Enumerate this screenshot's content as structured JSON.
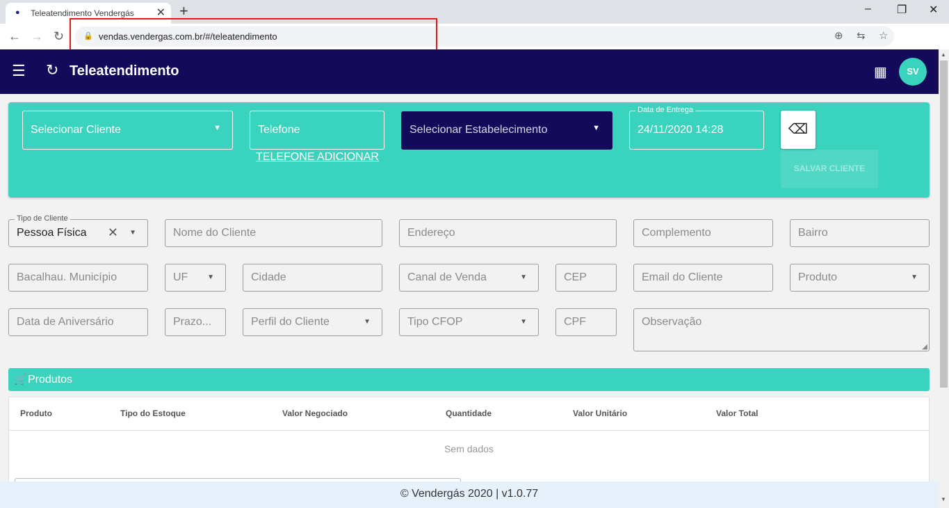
{
  "browser": {
    "tab_title": "Teleatendimento Vendergás",
    "url": "vendas.vendergas.com.br/#/teleatendimento"
  },
  "header": {
    "title": "Teleatendimento",
    "avatar_initials": "SV"
  },
  "top_form": {
    "cliente_placeholder": "Selecionar Cliente",
    "telefone_placeholder": "Telefone",
    "telefone_adicionar": "TELEFONE ADICIONAR",
    "estabelecimento_placeholder": "Selecionar Estabelecimento",
    "data_entrega_label": "Data de Entrega",
    "data_entrega_value": "24/11/2020 14:28",
    "salvar_cliente": "SALVAR CLIENTE"
  },
  "form": {
    "tipo_cliente_label": "Tipo de Cliente",
    "tipo_cliente_value": "Pessoa Física",
    "nome_cliente": "Nome do Cliente",
    "endereco": "Endereço",
    "complemento": "Complemento",
    "bairro": "Bairro",
    "municipio": "Bacalhau. Município",
    "uf": "UF",
    "cidade": "Cidade",
    "canal_venda": "Canal de Venda",
    "cep": "CEP",
    "email": "Email do Cliente",
    "produto": "Produto",
    "data_aniversario": "Data de Aniversário",
    "prazo": "Prazo...",
    "perfil_cliente": "Perfil do Cliente",
    "tipo_cfop": "Tipo CFOP",
    "cpf": "CPF",
    "observacao": "Observação"
  },
  "produtos": {
    "title": "Produtos",
    "columns": [
      "Produto",
      "Tipo do Estoque",
      "Valor Negociado",
      "Quantidade",
      "Valor Unitário",
      "Valor Total"
    ],
    "empty": "Sem dados"
  },
  "footer": "© Vendergás 2020 | v1.0.77",
  "colors": {
    "primary": "#140a5a",
    "accent": "#3ad3bd"
  }
}
